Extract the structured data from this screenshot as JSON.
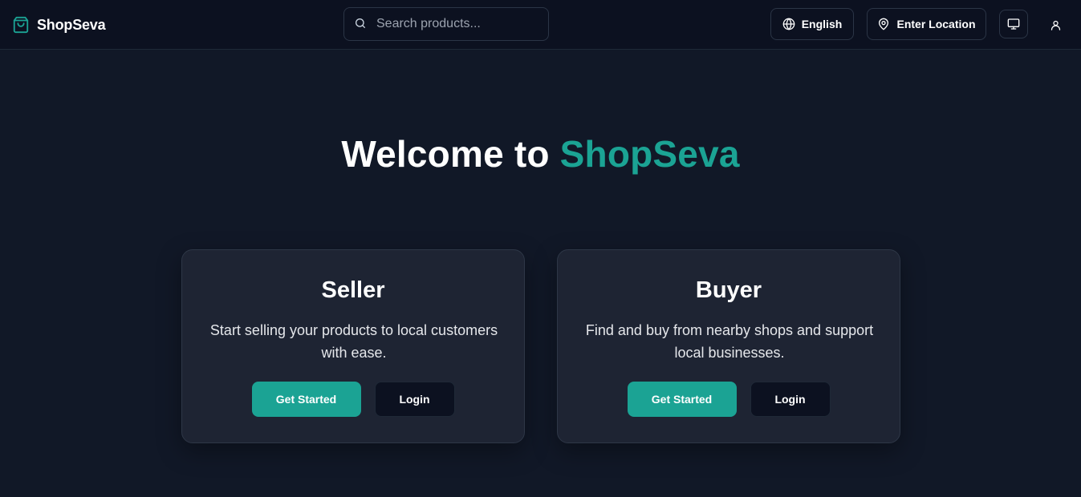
{
  "header": {
    "brand_name": "ShopSeva",
    "search_placeholder": "Search products...",
    "language_label": "English",
    "location_label": "Enter Location",
    "icons": {
      "brand": "shopping-bag-icon",
      "search": "search-icon",
      "language": "globe-icon",
      "location": "map-pin-icon",
      "theme": "monitor-icon",
      "account": "user-icon"
    }
  },
  "hero": {
    "title_prefix": "Welcome to",
    "title_brand": "ShopSeva"
  },
  "cards": [
    {
      "title": "Seller",
      "description": "Start selling your products to local customers with ease.",
      "primary_label": "Get Started",
      "secondary_label": "Login"
    },
    {
      "title": "Buyer",
      "description": "Find and buy from nearby shops and support local businesses.",
      "primary_label": "Get Started",
      "secondary_label": "Login"
    }
  ],
  "colors": {
    "background": "#111827",
    "header_background": "#0c1120",
    "card_background": "#1e2433",
    "accent": "#1ba394",
    "text": "#ffffff"
  }
}
